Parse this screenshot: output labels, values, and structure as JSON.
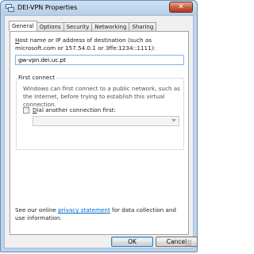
{
  "window": {
    "title": "DEI-VPN Properties",
    "close_label": "✕",
    "icon": "network-connection-icon"
  },
  "tabs": [
    {
      "label": "General",
      "active": true
    },
    {
      "label": "Options",
      "active": false
    },
    {
      "label": "Security",
      "active": false
    },
    {
      "label": "Networking",
      "active": false
    },
    {
      "label": "Sharing",
      "active": false
    }
  ],
  "general": {
    "host_label_mnemonic": "H",
    "host_label_rest": "ost name or IP address of destination (such as microsoft.com or 157.54.0.1 or 3ffe:1234::1111):",
    "host_value": "gw-vpn.dei.uc.pt",
    "first_connect": {
      "title": "First connect",
      "description": "Windows can first connect to a public network, such as the Internet, before trying to establish this virtual connection.",
      "checkbox_mnemonic": "D",
      "checkbox_rest": "ial another connection first:",
      "checkbox_checked": false,
      "dropdown_value": ""
    },
    "privacy_prefix": "See our online ",
    "privacy_link": "privacy statement",
    "privacy_suffix": " for data collection and use information."
  },
  "buttons": {
    "ok": "OK",
    "cancel": "Cancel"
  }
}
